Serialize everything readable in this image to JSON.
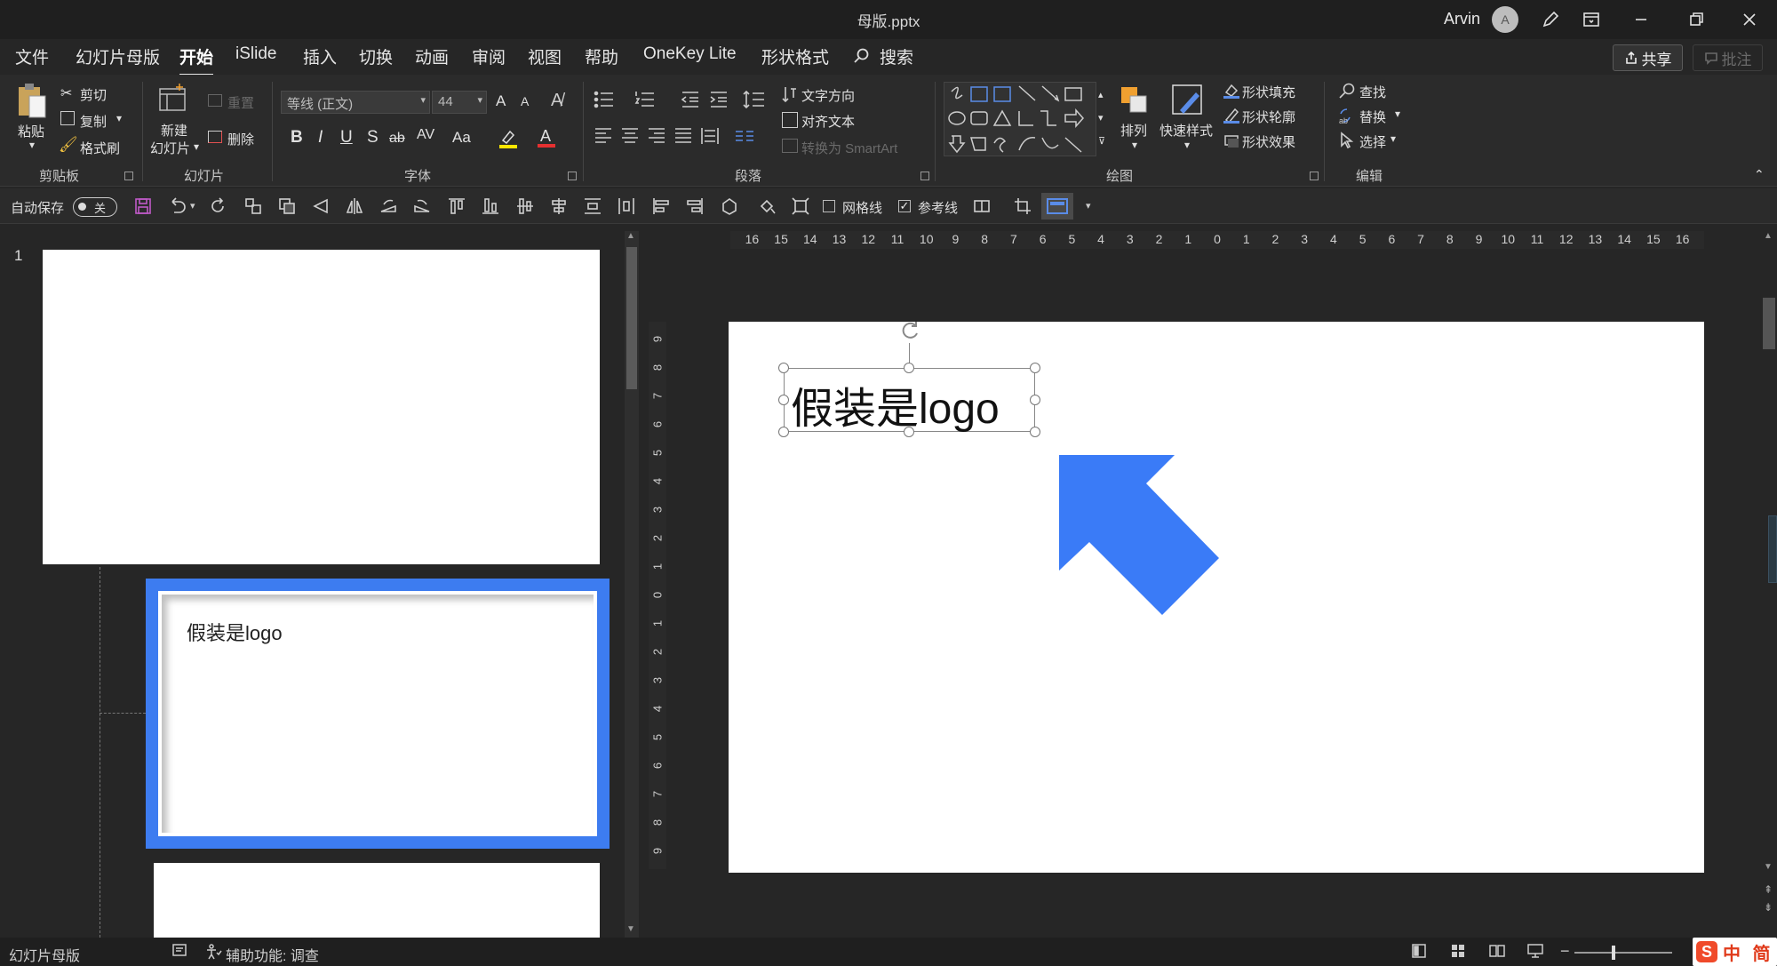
{
  "window": {
    "title": "母版.pptx",
    "user": "Arvin",
    "avatar_initial": "A"
  },
  "menu": {
    "tabs": [
      "文件",
      "幻灯片母版",
      "开始",
      "iSlide",
      "插入",
      "切换",
      "动画",
      "审阅",
      "视图",
      "帮助",
      "OneKey Lite",
      "形状格式"
    ],
    "active_tab": "开始",
    "search": "搜索",
    "share": "共享",
    "comment": "批注"
  },
  "ribbon": {
    "clipboard": {
      "label": "剪贴板",
      "paste": "粘贴",
      "cut": "剪切",
      "copy": "复制",
      "format_painter": "格式刷"
    },
    "slides": {
      "label": "幻灯片",
      "new_slide_1": "新建",
      "new_slide_2": "幻灯片",
      "reset": "重置",
      "delete": "删除"
    },
    "font": {
      "label": "字体",
      "font_name": "等线 (正文)",
      "font_size": "44",
      "bold": "B",
      "italic": "I",
      "underline": "U",
      "shadow": "S",
      "strike": "ab",
      "spacing": "AV",
      "case": "Aa",
      "grow": "A",
      "shrink": "A"
    },
    "paragraph": {
      "label": "段落",
      "text_direction": "文字方向",
      "align_text": "对齐文本",
      "smartart": "转换为 SmartArt"
    },
    "drawing": {
      "label": "绘图",
      "arrange": "排列",
      "quick_styles": "快速样式",
      "fill": "形状填充",
      "outline": "形状轮廓",
      "effects": "形状效果"
    },
    "editing": {
      "label": "编辑",
      "find": "查找",
      "replace": "替换",
      "select": "选择"
    }
  },
  "quickbar": {
    "autosave": "自动保存",
    "autosave_state": "关",
    "gridlines": "网格线",
    "guides": "参考线"
  },
  "thumbnails": {
    "slide_number": "1",
    "selected_text": "假装是logo"
  },
  "slide": {
    "logo_text": "假装是logo"
  },
  "ruler": {
    "horizontal": [
      "16",
      "15",
      "14",
      "13",
      "12",
      "11",
      "10",
      "9",
      "8",
      "7",
      "6",
      "5",
      "4",
      "3",
      "2",
      "1",
      "0",
      "1",
      "2",
      "3",
      "4",
      "5",
      "6",
      "7",
      "8",
      "9",
      "10",
      "11",
      "12",
      "13",
      "14",
      "15",
      "16"
    ],
    "vertical": [
      "9",
      "8",
      "7",
      "6",
      "5",
      "4",
      "3",
      "2",
      "1",
      "0",
      "1",
      "2",
      "3",
      "4",
      "5",
      "6",
      "7",
      "8",
      "9"
    ]
  },
  "statusbar": {
    "view": "幻灯片母版",
    "accessibility": "辅助功能: 调查",
    "ime": "中 简"
  },
  "colors": {
    "accent_blue": "#3d7cf0",
    "arrow_blue": "#3a7bf7",
    "bg": "#262626"
  }
}
